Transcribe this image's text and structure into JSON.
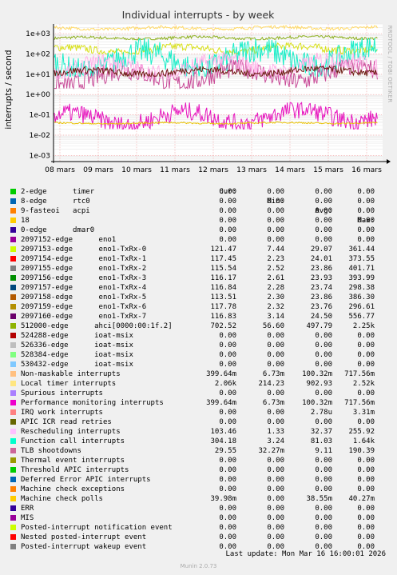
{
  "chart_data": {
    "type": "line",
    "title": "Individual interrupts - by week",
    "ylabel": "interrupts / second",
    "side_label": "RRDTOOL / TOBI OETIKER",
    "yscale": "log",
    "ylim": [
      0.0005,
      3000
    ],
    "y_ticks": [
      {
        "value": 1000,
        "label": "1e+03"
      },
      {
        "value": 100,
        "label": "1e+02"
      },
      {
        "value": 10,
        "label": "1e+01"
      },
      {
        "value": 1,
        "label": "1e+00"
      },
      {
        "value": 0.1,
        "label": "1e-01"
      },
      {
        "value": 0.01,
        "label": "1e-02"
      },
      {
        "value": 0.001,
        "label": "1e-03"
      }
    ],
    "x_ticks": [
      "08 mars",
      "09 mars",
      "10 mars",
      "11 mars",
      "12 mars",
      "13 mars",
      "14 mars",
      "15 mars",
      "16 mars"
    ],
    "grid": true,
    "series": [
      {
        "name": "512000-edge ahci[0000:00:1f.2]",
        "color": "#8fb021",
        "level": [
          500,
          800
        ]
      },
      {
        "name": "2097153-edge eno1-TxRx-0",
        "color": "#d8e01a",
        "level": [
          100,
          350
        ]
      },
      {
        "name": "Local timer interrupts",
        "color": "#ffd966",
        "level": [
          1500,
          2500
        ]
      },
      {
        "name": "Function call interrupts",
        "color": "#1aeec9",
        "level": [
          8,
          600
        ]
      },
      {
        "name": "TLB shootdowns",
        "color": "#c84c98",
        "level": [
          2,
          50
        ]
      },
      {
        "name": "Rescheduling interrupts",
        "color": "#ffb0e8",
        "level": [
          6,
          120
        ]
      },
      {
        "name": "2097160-edge eno1-TxRx-7",
        "color": "#6b1a10",
        "level": [
          8,
          25
        ]
      },
      {
        "name": "Performance monitoring interrupts",
        "color": "#e617be",
        "level": [
          0.02,
          0.4
        ]
      },
      {
        "name": "Machine check polls",
        "color": "#e8c000",
        "level": [
          0.035,
          0.045
        ]
      }
    ]
  },
  "legend": {
    "headers": {
      "cur": "Cur:",
      "min": "Min:",
      "avg": "Avg:",
      "max": "Max:"
    },
    "rows": [
      {
        "color": "#00cc00",
        "name": "2-edge      timer",
        "cur": "0.00",
        "min": "0.00",
        "avg": "0.00",
        "max": "0.00"
      },
      {
        "color": "#0066b3",
        "name": "8-edge      rtc0",
        "cur": "0.00",
        "min": "0.00",
        "avg": "0.00",
        "max": "0.00"
      },
      {
        "color": "#ff8000",
        "name": "9-fasteoi   acpi",
        "cur": "0.00",
        "min": "0.00",
        "avg": "0.00",
        "max": "0.00"
      },
      {
        "color": "#ffcc00",
        "name": "18",
        "cur": "0.00",
        "min": "0.00",
        "avg": "0.00",
        "max": "0.00"
      },
      {
        "color": "#330099",
        "name": "0-edge      dmar0",
        "cur": "0.00",
        "min": "0.00",
        "avg": "0.00",
        "max": "0.00"
      },
      {
        "color": "#990099",
        "name": "2097152-edge      eno1",
        "cur": "0.00",
        "min": "0.00",
        "avg": "0.00",
        "max": "0.00"
      },
      {
        "color": "#ccff00",
        "name": "2097153-edge      eno1-TxRx-0",
        "cur": "121.47",
        "min": "7.44",
        "avg": "29.07",
        "max": "361.44"
      },
      {
        "color": "#ff0000",
        "name": "2097154-edge      eno1-TxRx-1",
        "cur": "117.45",
        "min": "2.23",
        "avg": "24.01",
        "max": "373.55"
      },
      {
        "color": "#808080",
        "name": "2097155-edge      eno1-TxRx-2",
        "cur": "115.54",
        "min": "2.52",
        "avg": "23.86",
        "max": "401.71"
      },
      {
        "color": "#008f00",
        "name": "2097156-edge      eno1-TxRx-3",
        "cur": "116.17",
        "min": "2.61",
        "avg": "23.93",
        "max": "393.99"
      },
      {
        "color": "#00487d",
        "name": "2097157-edge      eno1-TxRx-4",
        "cur": "116.84",
        "min": "2.28",
        "avg": "23.74",
        "max": "298.38"
      },
      {
        "color": "#b35a00",
        "name": "2097158-edge      eno1-TxRx-5",
        "cur": "113.51",
        "min": "2.30",
        "avg": "23.86",
        "max": "386.30"
      },
      {
        "color": "#b38f00",
        "name": "2097159-edge      eno1-TxRx-6",
        "cur": "117.78",
        "min": "2.32",
        "avg": "23.76",
        "max": "296.61"
      },
      {
        "color": "#6b006b",
        "name": "2097160-edge      eno1-TxRx-7",
        "cur": "116.83",
        "min": "3.14",
        "avg": "24.50",
        "max": "556.77"
      },
      {
        "color": "#8fb300",
        "name": "512000-edge      ahci[0000:00:1f.2]",
        "cur": "702.52",
        "min": "56.60",
        "avg": "497.79",
        "max": "2.25k"
      },
      {
        "color": "#b30000",
        "name": "524288-edge      ioat-msix",
        "cur": "0.00",
        "min": "0.00",
        "avg": "0.00",
        "max": "0.00"
      },
      {
        "color": "#bebebe",
        "name": "526336-edge      ioat-msix",
        "cur": "0.00",
        "min": "0.00",
        "avg": "0.00",
        "max": "0.00"
      },
      {
        "color": "#80ff80",
        "name": "528384-edge      ioat-msix",
        "cur": "0.00",
        "min": "0.00",
        "avg": "0.00",
        "max": "0.00"
      },
      {
        "color": "#80c9ff",
        "name": "530432-edge      ioat-msix",
        "cur": "0.00",
        "min": "0.00",
        "avg": "0.00",
        "max": "0.00"
      },
      {
        "color": "#ffc080",
        "name": "Non-maskable interrupts",
        "cur": "399.64m",
        "min": "6.73m",
        "avg": "100.32m",
        "max": "717.56m"
      },
      {
        "color": "#ffe680",
        "name": "Local timer interrupts",
        "cur": "2.06k",
        "min": "214.23",
        "avg": "902.93",
        "max": "2.52k"
      },
      {
        "color": "#aa80ff",
        "name": "Spurious interrupts",
        "cur": "0.00",
        "min": "0.00",
        "avg": "0.00",
        "max": "0.00"
      },
      {
        "color": "#ee00cc",
        "name": "Performance monitoring interrupts",
        "cur": "399.64m",
        "min": "6.73m",
        "avg": "100.32m",
        "max": "717.56m"
      },
      {
        "color": "#ff8080",
        "name": "IRQ work interrupts",
        "cur": "0.00",
        "min": "0.00",
        "avg": "2.78u",
        "max": "3.31m"
      },
      {
        "color": "#666600",
        "name": "APIC ICR read retries",
        "cur": "0.00",
        "min": "0.00",
        "avg": "0.00",
        "max": "0.00"
      },
      {
        "color": "#ffbfff",
        "name": "Rescheduling interrupts",
        "cur": "103.46",
        "min": "1.33",
        "avg": "32.37",
        "max": "255.92"
      },
      {
        "color": "#00ffcc",
        "name": "Function call interrupts",
        "cur": "304.18",
        "min": "3.24",
        "avg": "81.03",
        "max": "1.64k"
      },
      {
        "color": "#cc6699",
        "name": "TLB shootdowns",
        "cur": "29.55",
        "min": "32.27m",
        "avg": "9.11",
        "max": "190.39"
      },
      {
        "color": "#999900",
        "name": "Thermal event interrupts",
        "cur": "0.00",
        "min": "0.00",
        "avg": "0.00",
        "max": "0.00"
      },
      {
        "color": "#00cc00",
        "name": "Threshold APIC interrupts",
        "cur": "0.00",
        "min": "0.00",
        "avg": "0.00",
        "max": "0.00"
      },
      {
        "color": "#0066b3",
        "name": "Deferred Error APIC interrupts",
        "cur": "0.00",
        "min": "0.00",
        "avg": "0.00",
        "max": "0.00"
      },
      {
        "color": "#ff8000",
        "name": "Machine check exceptions",
        "cur": "0.00",
        "min": "0.00",
        "avg": "0.00",
        "max": "0.00"
      },
      {
        "color": "#ffcc00",
        "name": "Machine check polls",
        "cur": "39.98m",
        "min": "0.00",
        "avg": "38.55m",
        "max": "40.27m"
      },
      {
        "color": "#330099",
        "name": "ERR",
        "cur": "0.00",
        "min": "0.00",
        "avg": "0.00",
        "max": "0.00"
      },
      {
        "color": "#990099",
        "name": "MIS",
        "cur": "0.00",
        "min": "0.00",
        "avg": "0.00",
        "max": "0.00"
      },
      {
        "color": "#ccff00",
        "name": "Posted-interrupt notification event",
        "cur": "0.00",
        "min": "0.00",
        "avg": "0.00",
        "max": "0.00"
      },
      {
        "color": "#ff0000",
        "name": "Nested posted-interrupt event",
        "cur": "0.00",
        "min": "0.00",
        "avg": "0.00",
        "max": "0.00"
      },
      {
        "color": "#808080",
        "name": "Posted-interrupt wakeup event",
        "cur": "0.00",
        "min": "0.00",
        "avg": "0.00",
        "max": "0.00"
      }
    ]
  },
  "footer": {
    "last_update": "Last update: Mon Mar 16 16:00:01 2026",
    "munin": "Munin 2.0.73"
  }
}
